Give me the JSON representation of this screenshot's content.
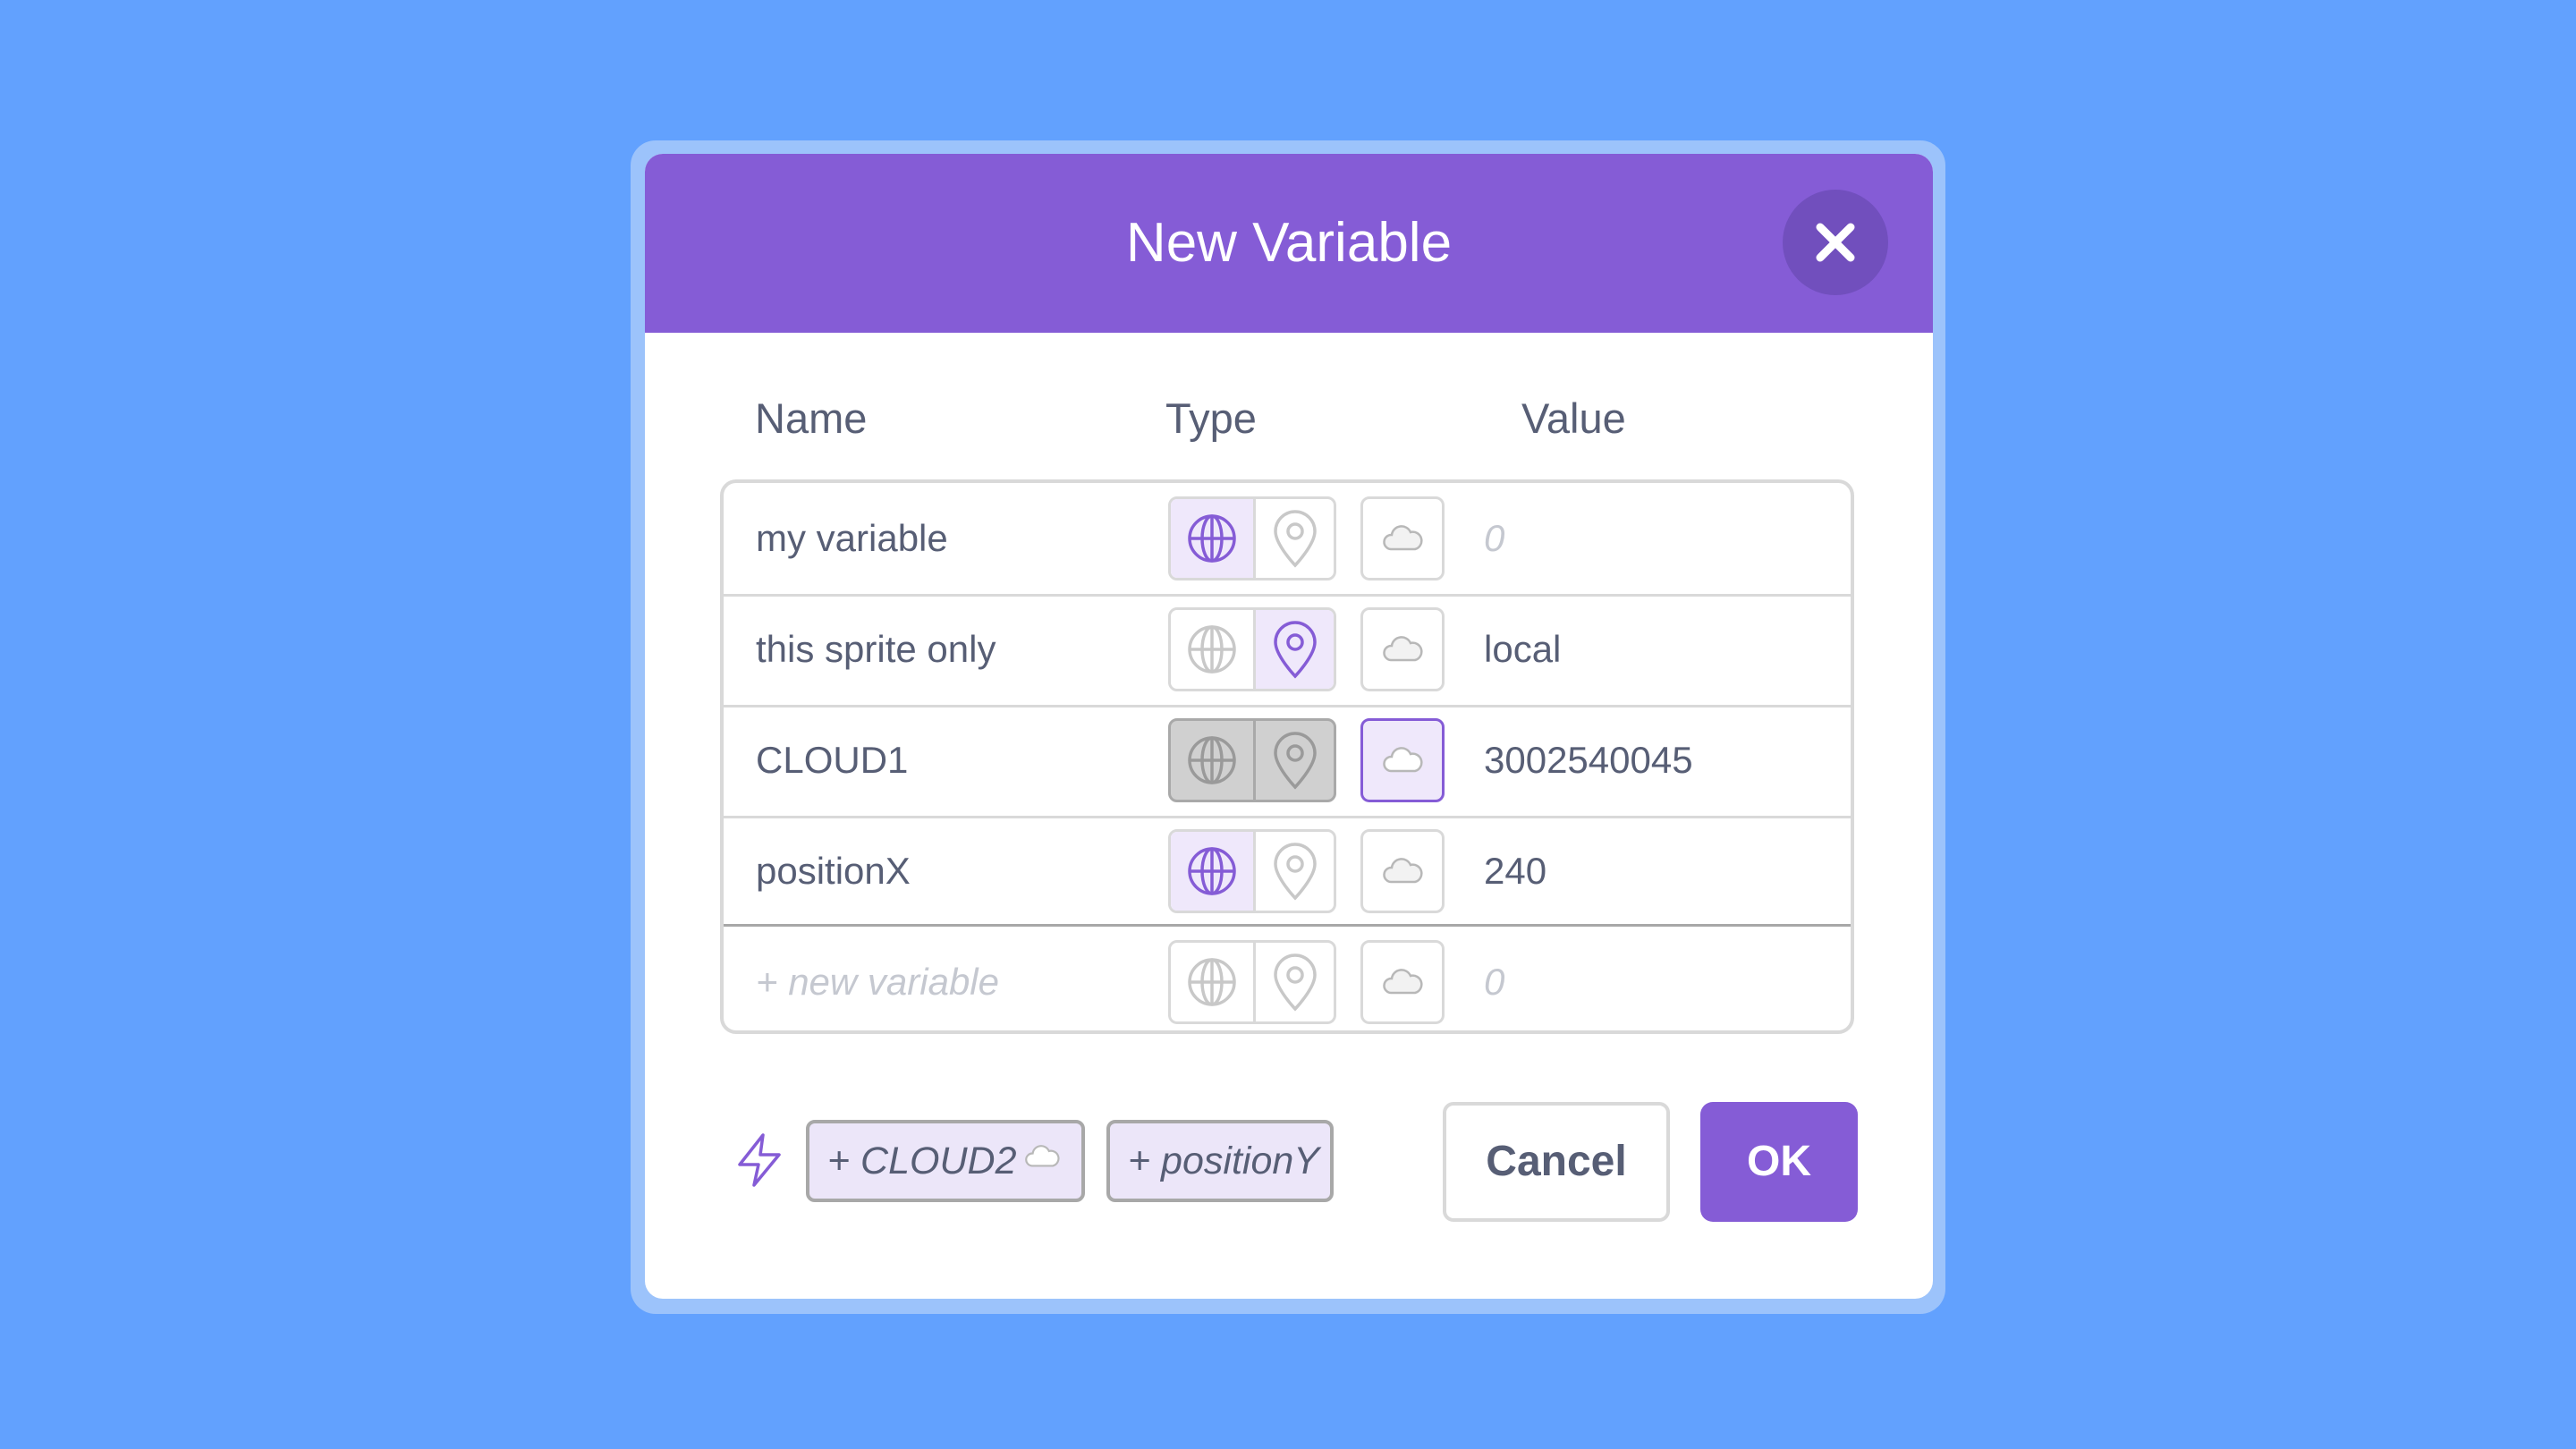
{
  "dialog": {
    "title": "New Variable",
    "close_icon": "close-icon"
  },
  "columns": {
    "name": "Name",
    "type": "Type",
    "value": "Value"
  },
  "variables": [
    {
      "name": "my variable",
      "scope": "global",
      "cloud": false,
      "value": "0",
      "value_is_placeholder": true
    },
    {
      "name": "this sprite only",
      "scope": "local",
      "cloud": false,
      "value": "local",
      "value_is_placeholder": false
    },
    {
      "name": "CLOUD1",
      "scope": "disabled",
      "cloud": true,
      "value": "3002540045",
      "value_is_placeholder": false
    },
    {
      "name": "positionX",
      "scope": "global",
      "cloud": false,
      "value": "240",
      "value_is_placeholder": false
    }
  ],
  "new_row": {
    "name_placeholder": "+ new variable",
    "value_placeholder": "0"
  },
  "suggestions": {
    "icon": "lightning-bolt-icon",
    "chips": [
      {
        "label": "+ CLOUD2",
        "cloud": true
      },
      {
        "label": "+ positionY",
        "cloud": false
      }
    ]
  },
  "buttons": {
    "cancel": "Cancel",
    "ok": "OK"
  },
  "colors": {
    "background": "#62a1fe",
    "accent": "#855cd6",
    "text": "#575e75",
    "border": "#d9d9d9"
  }
}
